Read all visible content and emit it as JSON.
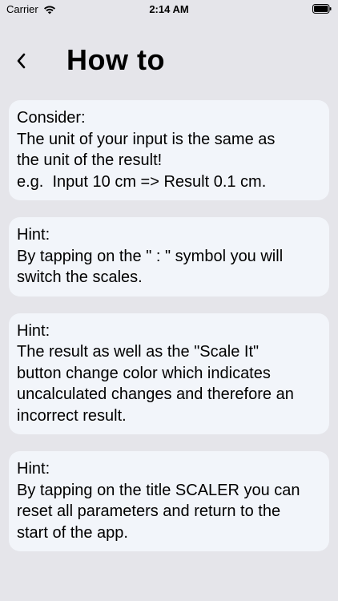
{
  "status_bar": {
    "carrier": "Carrier",
    "time": "2:14 AM",
    "icons": [
      "wifi-icon",
      "battery-icon"
    ]
  },
  "header": {
    "title": "How to",
    "back_icon": "chevron-left-icon"
  },
  "cards": [
    {
      "heading": "Consider:",
      "lines": [
        "The unit of your input is the same as",
        "the unit of the result!",
        "e.g.  Input 10 cm => Result 0.1 cm."
      ]
    },
    {
      "heading": "Hint:",
      "lines": [
        "By tapping on the \" : \" symbol you will",
        "switch the scales."
      ]
    },
    {
      "heading": "Hint:",
      "lines": [
        "The result as well as the \"Scale It\"",
        "button change color which indicates",
        "uncalculated changes and therefore an",
        "incorrect result."
      ]
    },
    {
      "heading": "Hint:",
      "lines": [
        "By tapping on the title SCALER you can",
        "reset all parameters and return to the",
        "start of the app."
      ]
    }
  ],
  "colors": {
    "background": "#e5e5ea",
    "card": "#f2f5fa",
    "text": "#000000"
  }
}
